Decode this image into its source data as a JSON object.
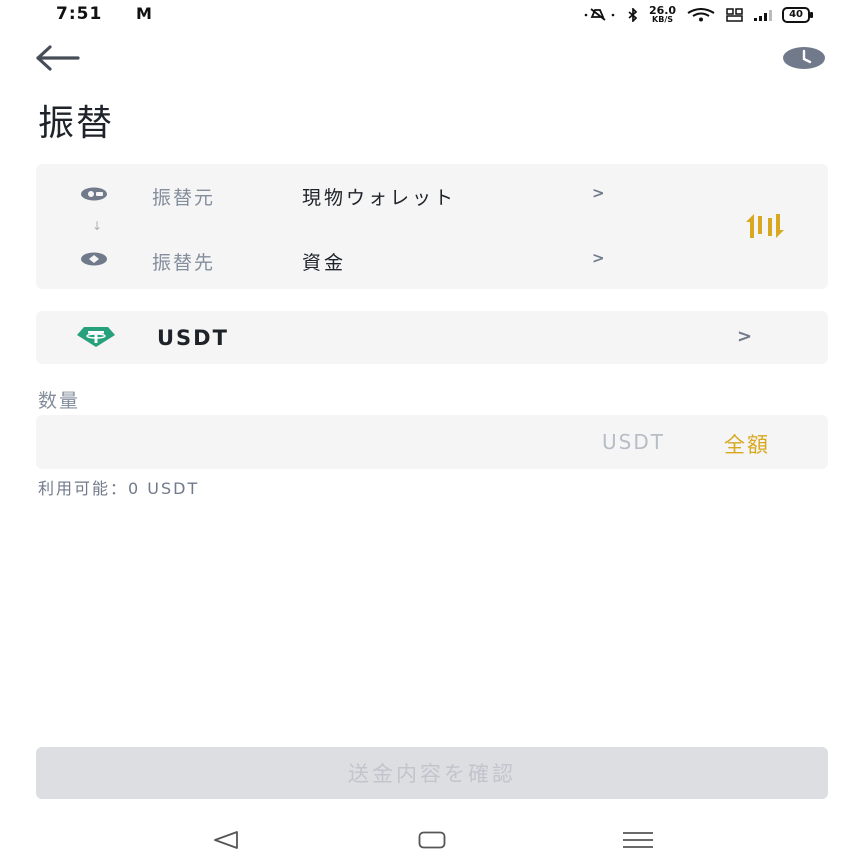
{
  "status_bar": {
    "time": "7:51",
    "mail_glyph": "M",
    "net_speed": "26.0",
    "net_unit": "KB/S",
    "battery": "40"
  },
  "header": {
    "title": "振替"
  },
  "transfer": {
    "from_label": "振替元",
    "from_value": "現物ウォレット",
    "to_label": "振替先",
    "to_value": "資金",
    "chevron": ">",
    "arrow_down": "↓"
  },
  "coin": {
    "name": "USDT",
    "chevron": ">"
  },
  "amount": {
    "label": "数量",
    "placeholder": "",
    "unit": "USDT",
    "max_label": "全額",
    "available": "利用可能：0 USDT"
  },
  "confirm": {
    "label": "送金内容を確認"
  },
  "colors": {
    "accent": "#d8a820",
    "card_bg": "#f5f5f5",
    "tether": "#26a17b",
    "disabled_button": "#dcdee2"
  },
  "icons": {
    "back": "arrow-left-icon",
    "history": "clock-icon",
    "swap": "swap-vertical-icon",
    "coin": "tether-icon"
  }
}
